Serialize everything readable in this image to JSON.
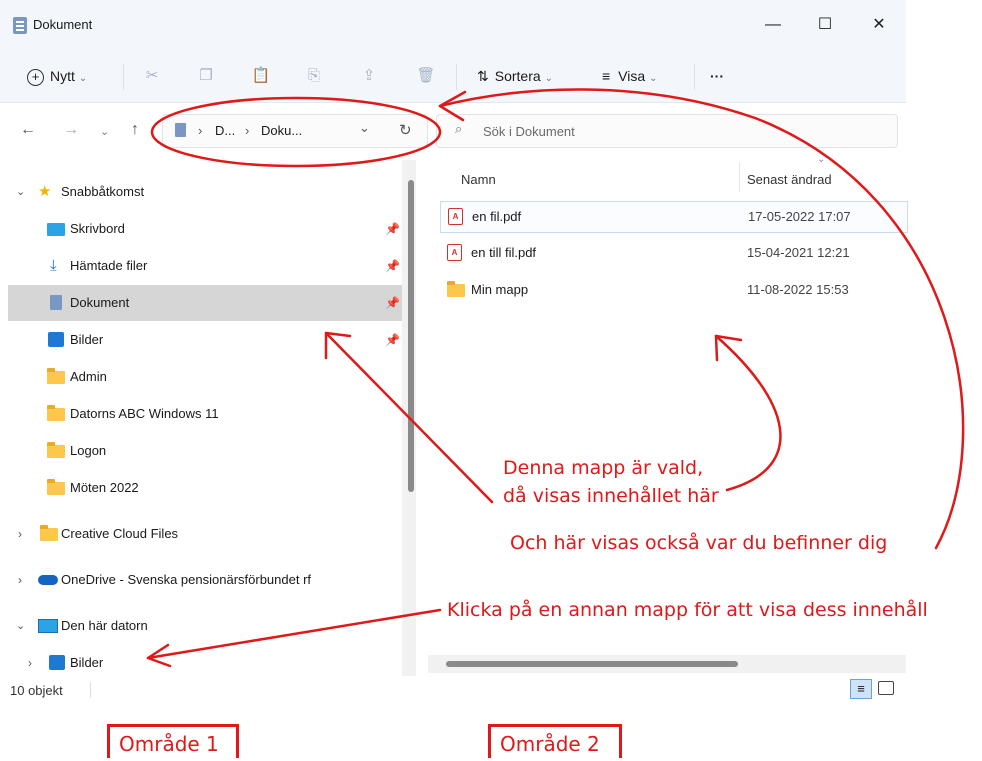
{
  "window": {
    "title": "Dokument",
    "controls": {
      "minimize": "—",
      "maximize": "☐",
      "close": "✕"
    }
  },
  "toolbar": {
    "new_label": "Nytt",
    "sort_label": "Sortera",
    "view_label": "Visa",
    "more_label": "···"
  },
  "address": {
    "path": [
      "D...",
      "Doku..."
    ]
  },
  "search": {
    "placeholder": "Sök i Dokument"
  },
  "sidebar": {
    "quick_access": "Snabbåtkomst",
    "items": [
      {
        "label": "Skrivbord",
        "icon": "desktop-icon",
        "pinned": true
      },
      {
        "label": "Hämtade filer",
        "icon": "download-icon",
        "pinned": true
      },
      {
        "label": "Dokument",
        "icon": "documents-icon",
        "pinned": true,
        "selected": true
      },
      {
        "label": "Bilder",
        "icon": "pictures-icon",
        "pinned": true
      },
      {
        "label": "Admin",
        "icon": "folder-icon"
      },
      {
        "label": "Datorns ABC Windows 11",
        "icon": "folder-icon"
      },
      {
        "label": "Logon",
        "icon": "folder-icon"
      },
      {
        "label": "Möten 2022",
        "icon": "folder-icon"
      }
    ],
    "creative_cloud": "Creative Cloud Files",
    "onedrive": "OneDrive - Svenska pensionärsförbundet rf",
    "this_pc": "Den här datorn",
    "pc_pictures": "Bilder"
  },
  "files": {
    "columns": {
      "name": "Namn",
      "modified": "Senast ändrad"
    },
    "rows": [
      {
        "name": "en fil.pdf",
        "modified": "17-05-2022 17:07",
        "type": "pdf"
      },
      {
        "name": "en till fil.pdf",
        "modified": "15-04-2021 12:21",
        "type": "pdf"
      },
      {
        "name": "Min mapp",
        "modified": "11-08-2022 15:53",
        "type": "folder"
      }
    ]
  },
  "status": {
    "count": "10 objekt"
  },
  "annotations": {
    "selected_line1": "Denna mapp är vald,",
    "selected_line2": "då visas innehållet här",
    "location": "Och här visas också var du befinner dig",
    "click_other": "Klicka på en annan mapp för att visa dess innehåll",
    "area1": "Område 1",
    "area2": "Område 2",
    "color": "#e01818"
  }
}
